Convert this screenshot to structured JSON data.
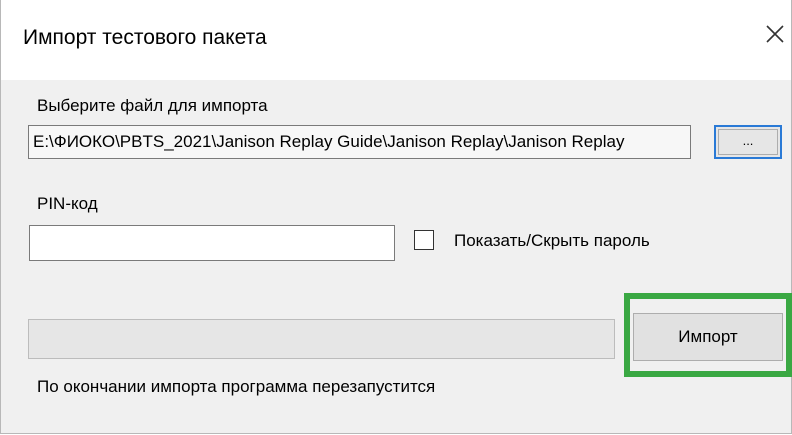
{
  "window": {
    "title": "Импорт тестового пакета",
    "close_icon": "close-icon"
  },
  "file": {
    "label": "Выберите файл для импорта",
    "path": "E:\\ФИОКО\\PBTS_2021\\Janison Replay Guide\\Janison Replay\\Janison Replay",
    "browse_label": "..."
  },
  "pin": {
    "label": "PIN-код",
    "value": "",
    "show_password_label": "Показать/Скрыть пароль",
    "show_password_checked": false
  },
  "import": {
    "progress": 0,
    "button_label": "Импорт",
    "highlight_color": "#3aa843",
    "status_text": "По окончании импорта программа перезапустится"
  }
}
